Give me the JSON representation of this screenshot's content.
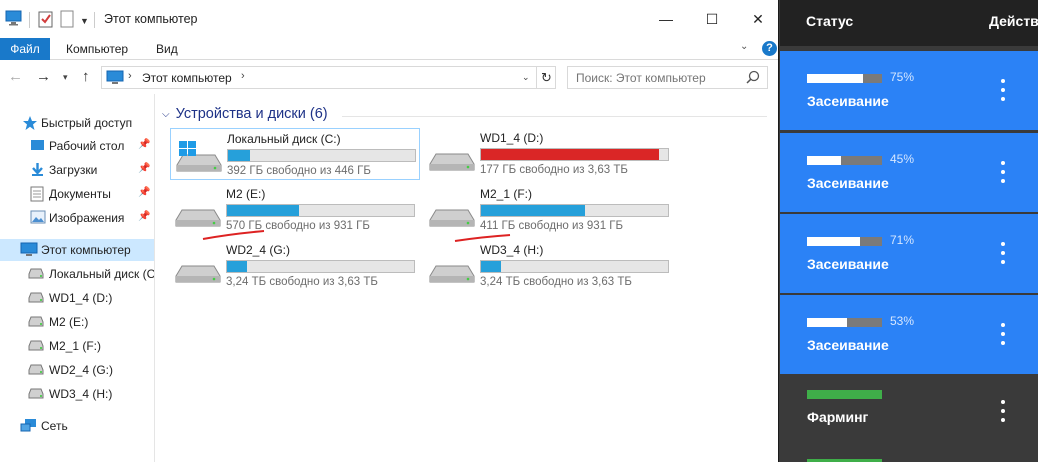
{
  "window": {
    "title": "Этот компьютер",
    "controls": {
      "minimize": "—",
      "maximize": "☐",
      "close": "✕"
    }
  },
  "ribbon": {
    "tabs": [
      "Файл",
      "Компьютер",
      "Вид"
    ],
    "help": "?"
  },
  "address": {
    "path": "Этот компьютер",
    "search_placeholder": "Поиск: Этот компьютер"
  },
  "nav_pane": {
    "items": [
      {
        "label": "Быстрый доступ",
        "icon": "star-icon"
      },
      {
        "label": "Рабочий стол",
        "icon": "desktop-icon",
        "pinned": true
      },
      {
        "label": "Загрузки",
        "icon": "download-icon",
        "pinned": true
      },
      {
        "label": "Документы",
        "icon": "documents-icon",
        "pinned": true
      },
      {
        "label": "Изображения",
        "icon": "pictures-icon",
        "pinned": true
      },
      {
        "label": "Этот компьютер",
        "icon": "pc-icon",
        "selected": true
      },
      {
        "label": "Локальный диск (С",
        "icon": "drive-icon"
      },
      {
        "label": "WD1_4 (D:)",
        "icon": "drive-icon"
      },
      {
        "label": "M2 (E:)",
        "icon": "drive-icon"
      },
      {
        "label": "M2_1 (F:)",
        "icon": "drive-icon"
      },
      {
        "label": "WD2_4 (G:)",
        "icon": "drive-icon"
      },
      {
        "label": "WD3_4 (H:)",
        "icon": "drive-icon"
      },
      {
        "label": "Сеть",
        "icon": "network-icon"
      }
    ]
  },
  "content": {
    "group_title": "Устройства и диски (6)",
    "drives": [
      {
        "name": "Локальный диск (C:)",
        "info": "392 ГБ свободно из 446 ГБ",
        "used_fraction": 0.12,
        "type": "system",
        "selected": true
      },
      {
        "name": "WD1_4 (D:)",
        "info": "177 ГБ свободно из 3,63 ТБ",
        "used_fraction": 0.95,
        "type": "hdd",
        "full": true
      },
      {
        "name": "M2 (E:)",
        "info": "570 ГБ свободно из 931 ГБ",
        "used_fraction": 0.39,
        "type": "hdd"
      },
      {
        "name": "M2_1 (F:)",
        "info": "411 ГБ свободно из 931 ГБ",
        "used_fraction": 0.56,
        "type": "hdd"
      },
      {
        "name": "WD2_4 (G:)",
        "info": "3,24 ТБ свободно из 3,63 ТБ",
        "used_fraction": 0.11,
        "type": "hdd"
      },
      {
        "name": "WD3_4 (H:)",
        "info": "3,24 ТБ свободно из 3,63 ТБ",
        "used_fraction": 0.11,
        "type": "hdd"
      }
    ]
  },
  "plots_panel": {
    "header_status": "Статус",
    "header_actions": "Действ",
    "accent_blue": "#2b82f6",
    "accent_green": "#3fae49",
    "rows": [
      {
        "percent": "75%",
        "progress": 0.75,
        "label": "Засеивание",
        "color": "#2b82f6"
      },
      {
        "percent": "45%",
        "progress": 0.45,
        "label": "Засеивание",
        "color": "#2b82f6"
      },
      {
        "percent": "71%",
        "progress": 0.71,
        "label": "Засеивание",
        "color": "#2b82f6"
      },
      {
        "percent": "53%",
        "progress": 0.53,
        "label": "Засеивание",
        "color": "#2b82f6"
      },
      {
        "percent": "",
        "progress": 1.0,
        "label": "Фарминг",
        "color": "#3a3a3a",
        "bar_color": "#3fae49"
      }
    ]
  }
}
